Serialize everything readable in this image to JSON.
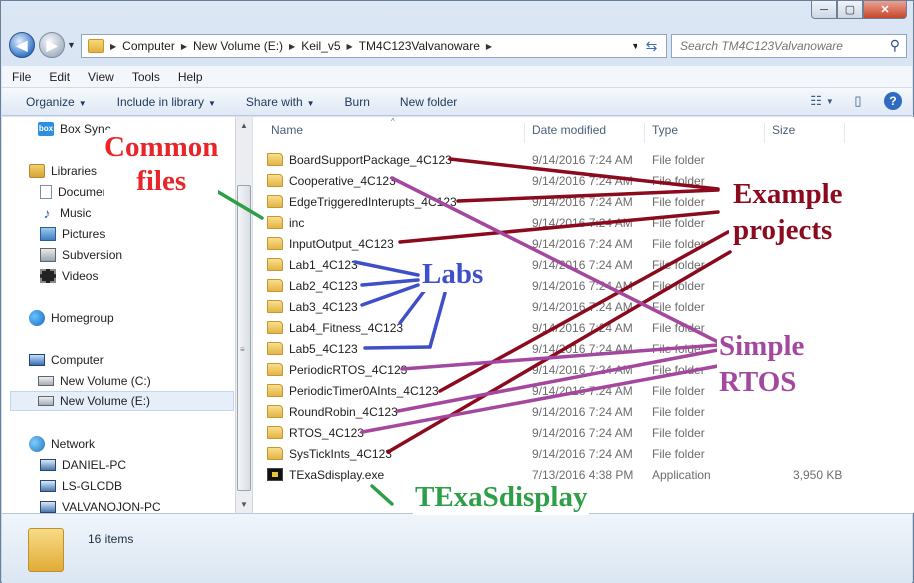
{
  "window": {
    "controls": {
      "minimize": "─",
      "maximize": "▢",
      "close": "✕"
    }
  },
  "address": {
    "crumbs": [
      "Computer",
      "New Volume (E:)",
      "Keil_v5",
      "TM4C123Valvanoware"
    ],
    "search_placeholder": "Search TM4C123Valvanoware"
  },
  "menu": [
    "File",
    "Edit",
    "View",
    "Tools",
    "Help"
  ],
  "toolbar": {
    "organize": "Organize",
    "include_in_library": "Include in library",
    "share_with": "Share with",
    "burn": "Burn",
    "new_folder": "New folder"
  },
  "nav": {
    "box_sync": "Box Sync",
    "libraries": "Libraries",
    "documents": "Documents",
    "music": "Music",
    "pictures": "Pictures",
    "subversion": "Subversion",
    "videos": "Videos",
    "homegroup": "Homegroup",
    "computer": "Computer",
    "volume_c": "New Volume (C:)",
    "volume_e": "New Volume (E:)",
    "network": "Network",
    "pc1": "DANIEL-PC",
    "pc2": "LS-GLCDB",
    "pc3": "VALVANOJON-PC"
  },
  "columns": {
    "name": "Name",
    "date": "Date modified",
    "type": "Type",
    "size": "Size"
  },
  "files": [
    {
      "name": "BoardSupportPackage_4C123",
      "date": "9/14/2016 7:24 AM",
      "type": "File folder",
      "size": ""
    },
    {
      "name": "Cooperative_4C123",
      "date": "9/14/2016 7:24 AM",
      "type": "File folder",
      "size": ""
    },
    {
      "name": "EdgeTriggeredInterupts_4C123",
      "date": "9/14/2016 7:24 AM",
      "type": "File folder",
      "size": ""
    },
    {
      "name": "inc",
      "date": "9/14/2016 7:24 AM",
      "type": "File folder",
      "size": ""
    },
    {
      "name": "InputOutput_4C123",
      "date": "9/14/2016 7:24 AM",
      "type": "File folder",
      "size": ""
    },
    {
      "name": "Lab1_4C123",
      "date": "9/14/2016 7:24 AM",
      "type": "File folder",
      "size": ""
    },
    {
      "name": "Lab2_4C123",
      "date": "9/14/2016 7:24 AM",
      "type": "File folder",
      "size": ""
    },
    {
      "name": "Lab3_4C123",
      "date": "9/14/2016 7:24 AM",
      "type": "File folder",
      "size": ""
    },
    {
      "name": "Lab4_Fitness_4C123",
      "date": "9/14/2016 7:24 AM",
      "type": "File folder",
      "size": ""
    },
    {
      "name": "Lab5_4C123",
      "date": "9/14/2016 7:24 AM",
      "type": "File folder",
      "size": ""
    },
    {
      "name": "PeriodicRTOS_4C123",
      "date": "9/14/2016 7:24 AM",
      "type": "File folder",
      "size": ""
    },
    {
      "name": "PeriodicTimer0AInts_4C123",
      "date": "9/14/2016 7:24 AM",
      "type": "File folder",
      "size": ""
    },
    {
      "name": "RoundRobin_4C123",
      "date": "9/14/2016 7:24 AM",
      "type": "File folder",
      "size": ""
    },
    {
      "name": "RTOS_4C123",
      "date": "9/14/2016 7:24 AM",
      "type": "File folder",
      "size": ""
    },
    {
      "name": "SysTickInts_4C123",
      "date": "9/14/2016 7:24 AM",
      "type": "File folder",
      "size": ""
    },
    {
      "name": "TExaSdisplay.exe",
      "date": "7/13/2016 4:38 PM",
      "type": "Application",
      "size": "3,950 KB"
    }
  ],
  "details": {
    "count": "16 items"
  },
  "annotations": {
    "common_files": [
      "Common",
      "files"
    ],
    "example_projects": [
      "Example",
      "projects"
    ],
    "labs": "Labs",
    "simple_rtos": [
      "Simple",
      "RTOS"
    ],
    "texasdisplay": "TExaSdisplay",
    "colors": {
      "common": "#e8262a",
      "example": "#8b0a1e",
      "labs": "#3f4fc8",
      "rtos": "#a3489e",
      "display": "#2e9e47"
    }
  }
}
